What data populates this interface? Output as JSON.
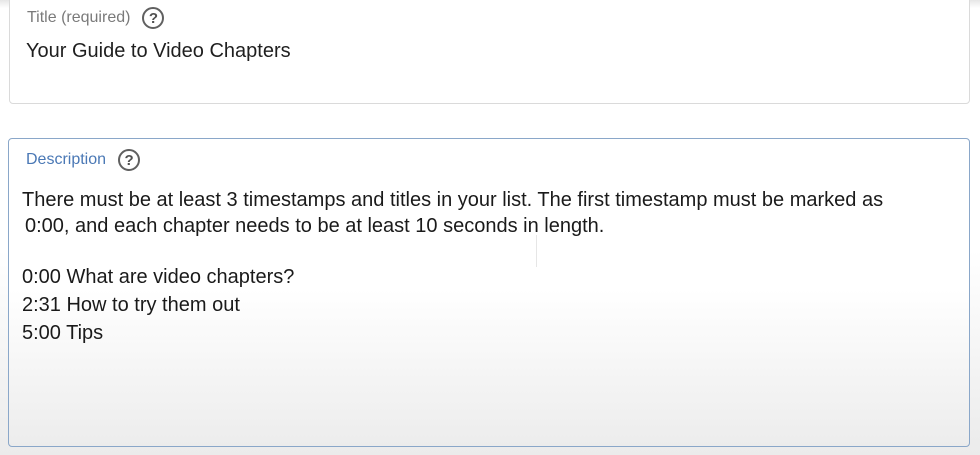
{
  "title_field": {
    "label": "Title (required)",
    "help_icon": "help-circle-icon",
    "value": "Your Guide to Video Chapters"
  },
  "description_field": {
    "label": "Description",
    "help_icon": "help-circle-icon",
    "paragraph_line_1": "There must be at least 3 timestamps and titles in your list. The first timestamp must be marked as",
    "paragraph_line_2": "0:00, and each chapter needs to be at least 10 seconds in length.",
    "chapters": [
      "0:00 What are video chapters?",
      "2:31 How to try them out",
      "5:00 Tips"
    ]
  },
  "colors": {
    "focused_border": "#8aa7c9",
    "focused_label": "#4a78b5",
    "idle_border": "#dadada",
    "idle_label": "#7a7a7a"
  }
}
